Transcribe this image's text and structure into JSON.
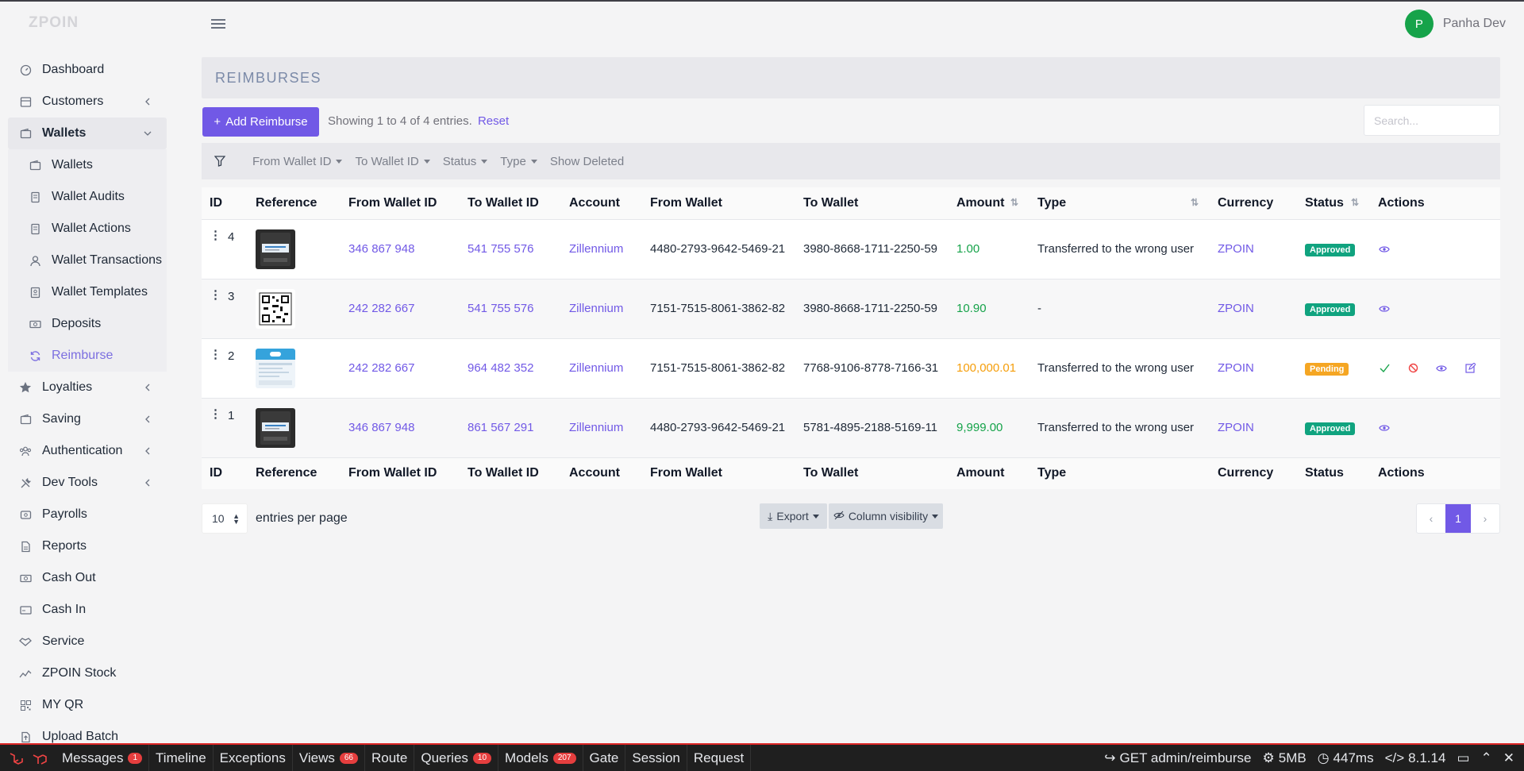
{
  "brand": "ZPOIN",
  "user": {
    "initial": "P",
    "name": "Panha Dev"
  },
  "sidebar": {
    "items": [
      {
        "label": "Dashboard",
        "icon": "gauge-icon"
      },
      {
        "label": "Customers",
        "icon": "customers-icon",
        "chevron": true
      },
      {
        "label": "Wallets",
        "icon": "wallet-icon",
        "chevron": true,
        "open": true,
        "children": [
          {
            "label": "Wallets",
            "icon": "wallet-icon"
          },
          {
            "label": "Wallet Audits",
            "icon": "document-icon"
          },
          {
            "label": "Wallet Actions",
            "icon": "document-icon"
          },
          {
            "label": "Wallet Transactions",
            "icon": "user-icon"
          },
          {
            "label": "Wallet Templates",
            "icon": "template-icon"
          },
          {
            "label": "Deposits",
            "icon": "cash-icon"
          },
          {
            "label": "Reimburse",
            "icon": "refresh-icon",
            "active": true
          }
        ]
      },
      {
        "label": "Loyalties",
        "icon": "star-icon",
        "chevron": true
      },
      {
        "label": "Saving",
        "icon": "wallet-icon",
        "chevron": true
      },
      {
        "label": "Authentication",
        "icon": "group-icon",
        "chevron": true
      },
      {
        "label": "Dev Tools",
        "icon": "tools-icon",
        "chevron": true
      },
      {
        "label": "Payrolls",
        "icon": "payroll-icon"
      },
      {
        "label": "Reports",
        "icon": "report-icon"
      },
      {
        "label": "Cash Out",
        "icon": "cash-icon"
      },
      {
        "label": "Cash In",
        "icon": "card-icon"
      },
      {
        "label": "Service",
        "icon": "handshake-icon"
      },
      {
        "label": "ZPOIN Stock",
        "icon": "chart-line-icon"
      },
      {
        "label": "MY QR",
        "icon": "qr-icon"
      },
      {
        "label": "Upload Batch",
        "icon": "upload-icon"
      }
    ]
  },
  "page": {
    "title": "REIMBURSES",
    "add_label": "Add Reimburse",
    "showing": "Showing 1 to 4 of 4 entries.",
    "reset": "Reset",
    "search_placeholder": "Search..."
  },
  "filters": [
    "From Wallet ID",
    "To Wallet ID",
    "Status",
    "Type",
    "Show Deleted"
  ],
  "table": {
    "headers": [
      "ID",
      "Reference",
      "From Wallet ID",
      "To Wallet ID",
      "Account",
      "From Wallet",
      "To Wallet",
      "Amount",
      "Type",
      "Currency",
      "Status",
      "Actions"
    ],
    "rows": [
      {
        "id": "4",
        "ref": "phone",
        "from_id": "346 867 948",
        "to_id": "541 755 576",
        "account": "Zillennium",
        "from_wallet": "4480-2793-9642-5469-21",
        "to_wallet": "3980-8668-1711-2250-59",
        "amount": "1.00",
        "amount_color": "green",
        "type": "Transferred to the wrong user",
        "currency": "ZPOIN",
        "status": "Approved",
        "actions": [
          "view"
        ]
      },
      {
        "id": "3",
        "ref": "qr",
        "from_id": "242 282 667",
        "to_id": "541 755 576",
        "account": "Zillennium",
        "from_wallet": "7151-7515-8061-3862-82",
        "to_wallet": "3980-8668-1711-2250-59",
        "amount": "10.90",
        "amount_color": "green",
        "type": "-",
        "currency": "ZPOIN",
        "status": "Approved",
        "actions": [
          "view"
        ]
      },
      {
        "id": "2",
        "ref": "receipt",
        "from_id": "242 282 667",
        "to_id": "964 482 352",
        "account": "Zillennium",
        "from_wallet": "7151-7515-8061-3862-82",
        "to_wallet": "7768-9106-8778-7166-31",
        "amount": "100,000.01",
        "amount_color": "orange",
        "type": "Transferred to the wrong user",
        "currency": "ZPOIN",
        "status": "Pending",
        "actions": [
          "approve",
          "reject",
          "view",
          "edit"
        ]
      },
      {
        "id": "1",
        "ref": "phone",
        "from_id": "346 867 948",
        "to_id": "861 567 291",
        "account": "Zillennium",
        "from_wallet": "4480-2793-9642-5469-21",
        "to_wallet": "5781-4895-2188-5169-11",
        "amount": "9,999.00",
        "amount_color": "green",
        "type": "Transferred to the wrong user",
        "currency": "ZPOIN",
        "status": "Approved",
        "actions": [
          "view"
        ]
      }
    ]
  },
  "footer": {
    "per_page": "10",
    "per_page_label": "entries per page",
    "export": "Export",
    "column_visibility": "Column visibility",
    "current_page": "1"
  },
  "debugbar": {
    "tabs": [
      {
        "label": "Messages",
        "count": "1"
      },
      {
        "label": "Timeline"
      },
      {
        "label": "Exceptions"
      },
      {
        "label": "Views",
        "count": "66"
      },
      {
        "label": "Route"
      },
      {
        "label": "Queries",
        "count": "10"
      },
      {
        "label": "Models",
        "count": "207"
      },
      {
        "label": "Gate"
      },
      {
        "label": "Session"
      },
      {
        "label": "Request"
      }
    ],
    "request": "GET admin/reimburse",
    "memory": "5MB",
    "time": "447ms",
    "php": "8.1.14"
  },
  "colors": {
    "accent": "#7159e6",
    "approved": "#10a37f",
    "pending": "#f5a623",
    "green": "#16a34a",
    "orange": "#f59e0b"
  }
}
